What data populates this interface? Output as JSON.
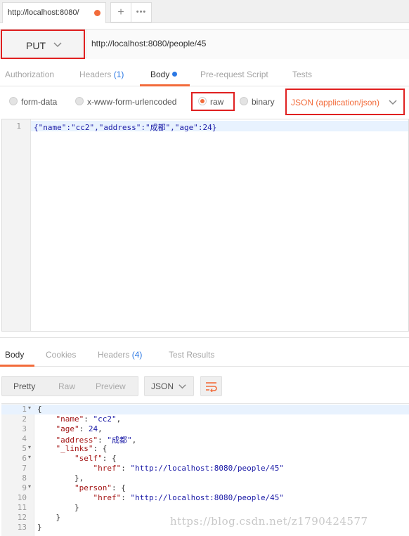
{
  "tabs": {
    "active_title": "http://localhost:8080/",
    "plus": "+",
    "more": "•••"
  },
  "request": {
    "method": "PUT",
    "url": "http://localhost:8080/people/45"
  },
  "request_tabs": {
    "authorization": "Authorization",
    "headers": "Headers",
    "headers_count": "(1)",
    "body": "Body",
    "prerequest": "Pre-request Script",
    "tests": "Tests"
  },
  "body_types": {
    "form_data": "form-data",
    "urlencoded": "x-www-form-urlencoded",
    "raw": "raw",
    "binary": "binary",
    "selected": "raw",
    "content_type": "JSON (application/json)"
  },
  "request_editor": {
    "line_numbers": [
      "1"
    ],
    "lines": [
      "{\"name\":\"cc2\",\"address\":\"成都\",\"age\":24}"
    ]
  },
  "response_tabs": {
    "body": "Body",
    "cookies": "Cookies",
    "headers": "Headers",
    "headers_count": "(4)",
    "test_results": "Test Results"
  },
  "response_toolbar": {
    "pretty": "Pretty",
    "raw": "Raw",
    "preview": "Preview",
    "format": "JSON"
  },
  "response_editor": {
    "lines": [
      {
        "num": "1",
        "fold": "▾",
        "k": "",
        "text": "{"
      },
      {
        "num": "2",
        "fold": "",
        "text": "    \"name\": \"cc2\","
      },
      {
        "num": "3",
        "fold": "",
        "text": "    \"age\": 24,"
      },
      {
        "num": "4",
        "fold": "",
        "text": "    \"address\": \"成都\","
      },
      {
        "num": "5",
        "fold": "▾",
        "text": "    \"_links\": {"
      },
      {
        "num": "6",
        "fold": "▾",
        "text": "        \"self\": {"
      },
      {
        "num": "7",
        "fold": "",
        "text": "            \"href\": \"http://localhost:8080/people/45\""
      },
      {
        "num": "8",
        "fold": "",
        "text": "        },"
      },
      {
        "num": "9",
        "fold": "▾",
        "text": "        \"person\": {"
      },
      {
        "num": "10",
        "fold": "",
        "text": "            \"href\": \"http://localhost:8080/people/45\""
      },
      {
        "num": "11",
        "fold": "",
        "text": "        }"
      },
      {
        "num": "12",
        "fold": "",
        "text": "    }"
      },
      {
        "num": "13",
        "fold": "",
        "text": "}"
      }
    ]
  },
  "watermark": "https://blog.csdn.net/z1790424577",
  "colors": {
    "accent": "#f26b3a",
    "highlight_box": "#e02020",
    "count_blue": "#2b78e4"
  }
}
